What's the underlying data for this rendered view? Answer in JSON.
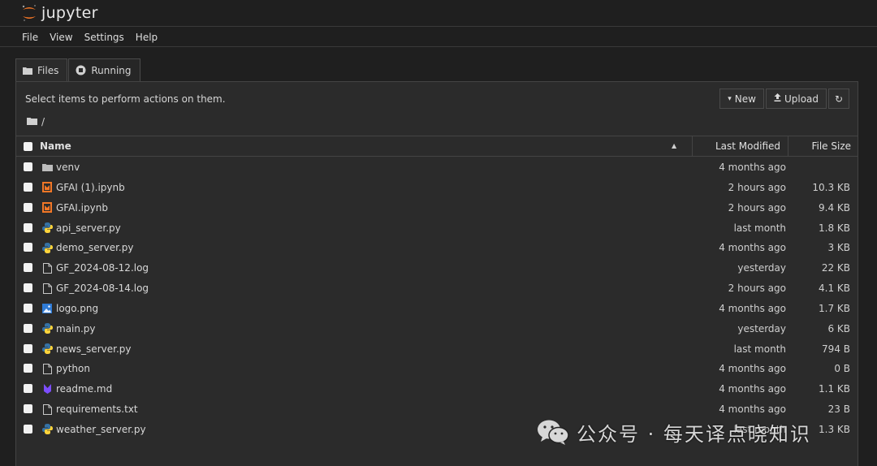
{
  "app": {
    "logo_text": "jupyter"
  },
  "menu": [
    "File",
    "View",
    "Settings",
    "Help"
  ],
  "tabs": [
    {
      "label": "Files",
      "icon": "folder-icon"
    },
    {
      "label": "Running",
      "icon": "running-icon"
    }
  ],
  "toolbar": {
    "hint": "Select items to perform actions on them.",
    "new_label": "New",
    "upload_label": "Upload",
    "refresh_icon": "refresh-icon"
  },
  "breadcrumb": {
    "path": "/"
  },
  "table": {
    "headers": {
      "name": "Name",
      "modified": "Last Modified",
      "size": "File Size"
    },
    "rows": [
      {
        "name": "venv",
        "type": "folder",
        "modified": "4 months ago",
        "size": ""
      },
      {
        "name": "GFAI (1).ipynb",
        "type": "notebook",
        "modified": "2 hours ago",
        "size": "10.3 KB"
      },
      {
        "name": "GFAI.ipynb",
        "type": "notebook",
        "modified": "2 hours ago",
        "size": "9.4 KB"
      },
      {
        "name": "api_server.py",
        "type": "python",
        "modified": "last month",
        "size": "1.8 KB"
      },
      {
        "name": "demo_server.py",
        "type": "python",
        "modified": "4 months ago",
        "size": "3 KB"
      },
      {
        "name": "GF_2024-08-12.log",
        "type": "file",
        "modified": "yesterday",
        "size": "22 KB"
      },
      {
        "name": "GF_2024-08-14.log",
        "type": "file",
        "modified": "2 hours ago",
        "size": "4.1 KB"
      },
      {
        "name": "logo.png",
        "type": "image",
        "modified": "4 months ago",
        "size": "1.7 KB"
      },
      {
        "name": "main.py",
        "type": "python",
        "modified": "yesterday",
        "size": "6 KB"
      },
      {
        "name": "news_server.py",
        "type": "python",
        "modified": "last month",
        "size": "794 B"
      },
      {
        "name": "python",
        "type": "file",
        "modified": "4 months ago",
        "size": "0 B"
      },
      {
        "name": "readme.md",
        "type": "markdown",
        "modified": "4 months ago",
        "size": "1.1 KB"
      },
      {
        "name": "requirements.txt",
        "type": "file",
        "modified": "4 months ago",
        "size": "23 B"
      },
      {
        "name": "weather_server.py",
        "type": "python",
        "modified": "last month",
        "size": "1.3 KB"
      }
    ]
  },
  "watermark": {
    "text": "公众号 · 每天译点晓知识"
  },
  "colors": {
    "background": "#1f1f1f",
    "panel": "#2b2b2b",
    "jupyter_orange": "#f37626",
    "notebook_orange": "#f37726",
    "python_blue": "#3572a5",
    "python_yellow": "#ffd43b",
    "markdown_purple": "#7c4dff",
    "image_blue": "#2f7bd6"
  }
}
